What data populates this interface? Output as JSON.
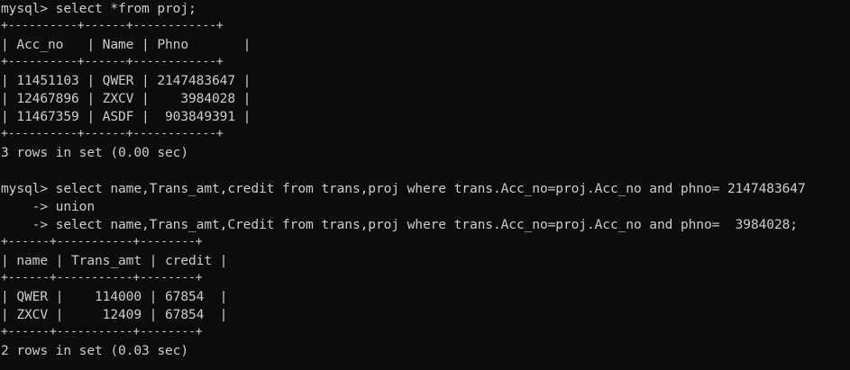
{
  "terminal": {
    "lines": [
      "mysql> select *from proj;",
      "+----------+------+------------+",
      "| Acc_no   | Name | Phno       |",
      "+----------+------+------------+",
      "| 11451103 | QWER | 2147483647 |",
      "| 12467896 | ZXCV |    3984028 |",
      "| 11467359 | ASDF |  903849391 |",
      "+----------+------+------------+",
      "3 rows in set (0.00 sec)",
      "",
      "mysql> select name,Trans_amt,credit from trans,proj where trans.Acc_no=proj.Acc_no and phno= 2147483647",
      "    -> union",
      "    -> select name,Trans_amt,Credit from trans,proj where trans.Acc_no=proj.Acc_no and phno=  3984028;",
      "+------+-----------+--------+",
      "| name | Trans_amt | credit |",
      "+------+-----------+--------+",
      "| QWER |    114000 | 67854  |",
      "| ZXCV |     12409 | 67854  |",
      "+------+-----------+--------+",
      "2 rows in set (0.03 sec)"
    ]
  }
}
